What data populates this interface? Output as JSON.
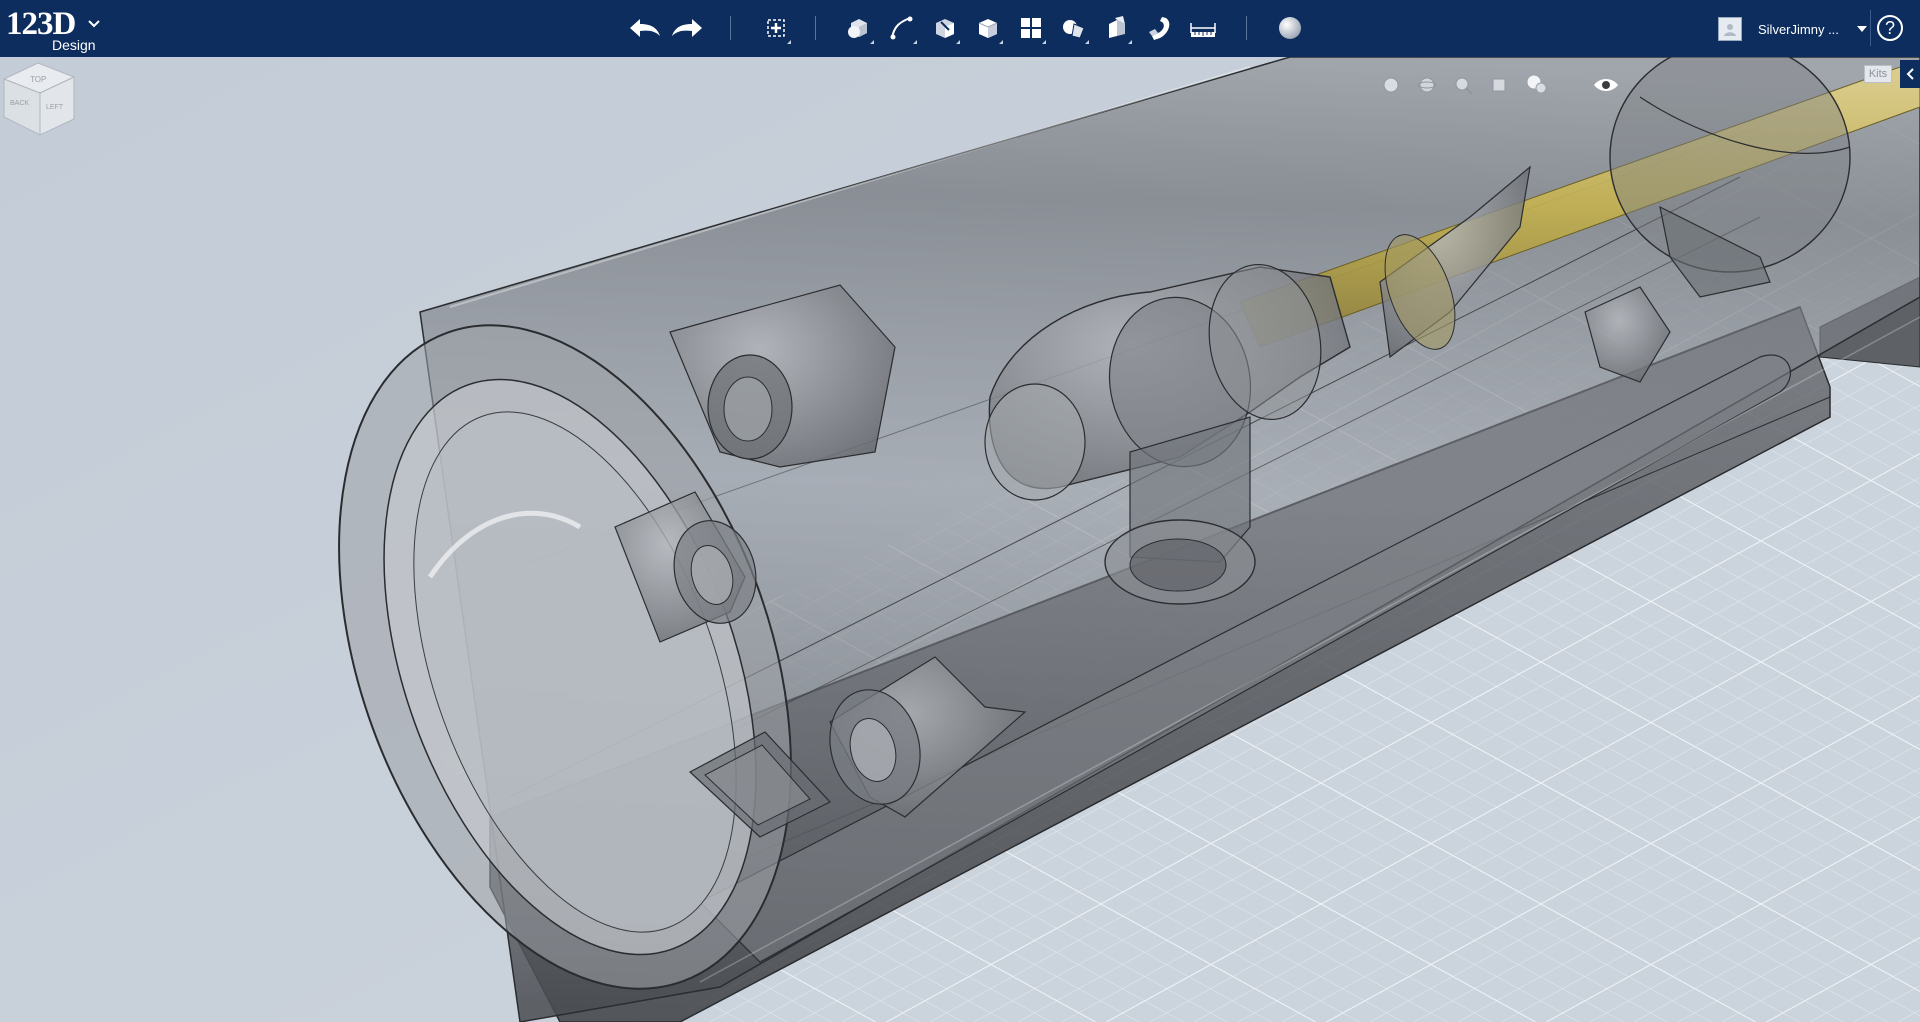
{
  "app": {
    "logo_main": "123D",
    "logo_sub": "Design"
  },
  "toolbar": {
    "tools": [
      {
        "name": "undo-button",
        "icon": "undo-arrow-icon"
      },
      {
        "name": "redo-button",
        "icon": "redo-arrow-icon"
      },
      {
        "name": "transform-button",
        "icon": "transform-icon"
      },
      {
        "name": "primitives-button",
        "icon": "primitives-icon"
      },
      {
        "name": "sketch-button",
        "icon": "sketch-icon"
      },
      {
        "name": "construct-button",
        "icon": "construct-icon"
      },
      {
        "name": "modify-button",
        "icon": "modify-icon"
      },
      {
        "name": "pattern-button",
        "icon": "pattern-icon"
      },
      {
        "name": "grouping-button",
        "icon": "grouping-icon"
      },
      {
        "name": "combine-button",
        "icon": "combine-icon"
      },
      {
        "name": "snap-button",
        "icon": "snap-magnet-icon"
      },
      {
        "name": "measure-button",
        "icon": "measure-ruler-icon"
      },
      {
        "name": "material-button",
        "icon": "material-sphere-icon"
      }
    ]
  },
  "user": {
    "name": "SilverJimny ..."
  },
  "help": {
    "label": "?"
  },
  "side_panel": {
    "kits_label": "Kits"
  },
  "viewcube": {
    "faces": [
      "TOP",
      "BACK",
      "LEFT"
    ]
  },
  "colors": {
    "topbar": "#0c2d5e",
    "background": "#c6ced8",
    "grid": "#e9edf2",
    "model_glass": "#707070",
    "rod_gold": "#c9b44a"
  }
}
